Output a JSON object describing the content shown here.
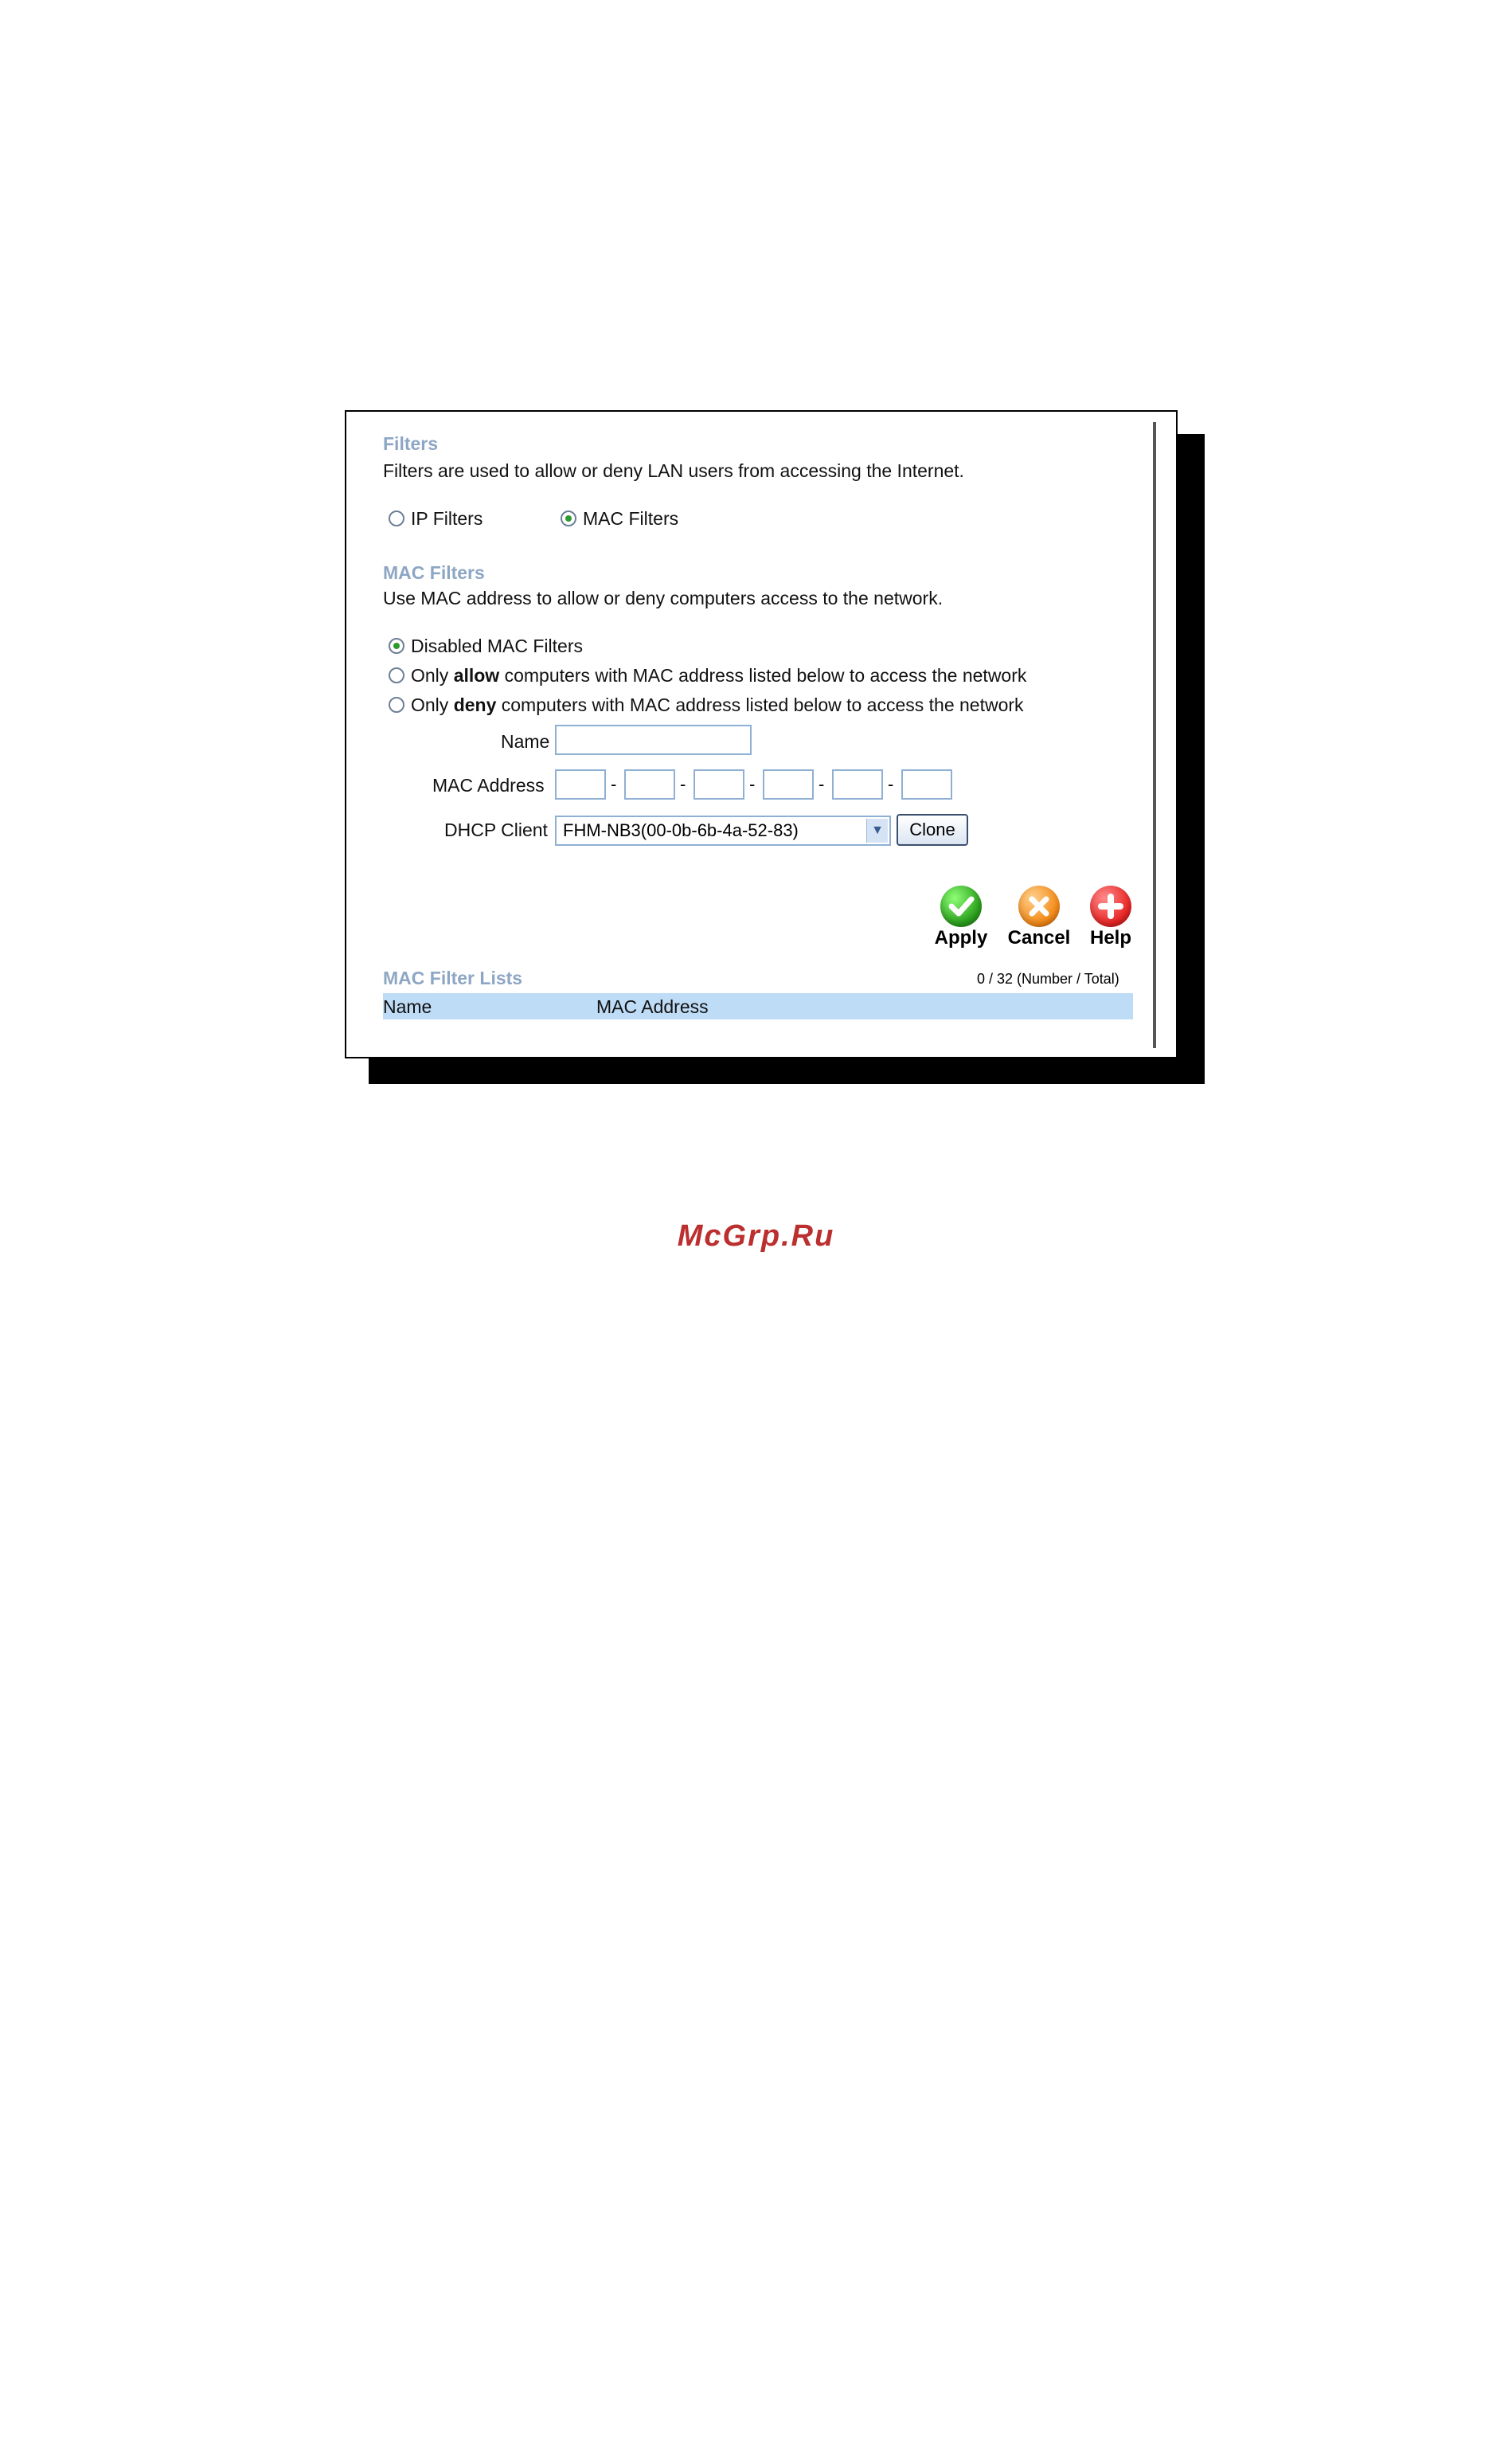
{
  "filters": {
    "title": "Filters",
    "description": "Filters are used to allow or deny LAN users from accessing the Internet.",
    "ip_filters_label": "IP Filters",
    "mac_filters_label": "MAC Filters",
    "selected": "MAC Filters"
  },
  "mac_filters": {
    "title": "MAC Filters",
    "description": "Use MAC address to allow or deny computers access to the network.",
    "options": [
      {
        "label": "Disabled MAC Filters",
        "checked": true
      },
      {
        "prefix": "Only ",
        "bold": "allow",
        "suffix": " computers with MAC address listed below to access the network",
        "checked": false
      },
      {
        "prefix": "Only ",
        "bold": "deny",
        "suffix": " computers with MAC address listed below to access the network",
        "checked": false
      }
    ],
    "name_label": "Name",
    "name_value": "",
    "mac_label": "MAC Address",
    "mac_separator": "-",
    "dhcp_label": "DHCP Client",
    "dhcp_selected": "FHM-NB3(00-0b-6b-4a-52-83)",
    "clone_label": "Clone"
  },
  "actions": {
    "apply": "Apply",
    "cancel": "Cancel",
    "help": "Help",
    "apply_icon": "check-icon",
    "cancel_icon": "x-icon",
    "help_icon": "plus-icon"
  },
  "list": {
    "title": "MAC Filter Lists",
    "count": "0 / 32 (Number / Total)",
    "col_name": "Name",
    "col_mac": "MAC Address"
  },
  "watermark": "McGrp.Ru",
  "colors": {
    "heading": "#8da6c4",
    "table_header": "#bfdcf7",
    "watermark": "#bc2f2f"
  }
}
